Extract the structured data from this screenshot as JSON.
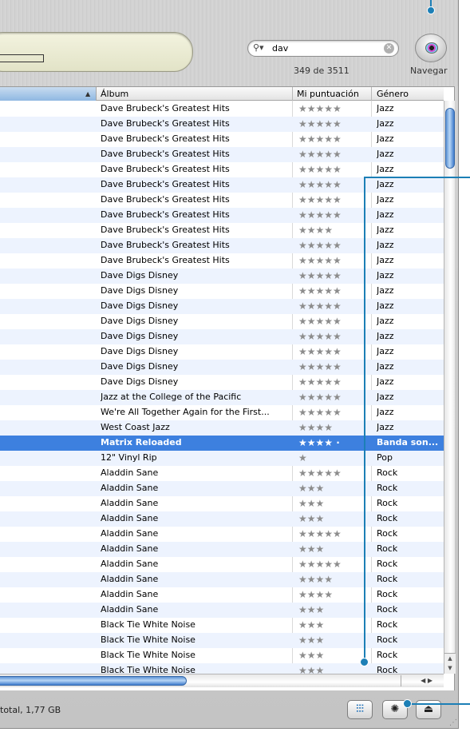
{
  "search": {
    "value": "dav",
    "placeholder": ""
  },
  "result_count": "349 de 3511",
  "browse_label": "Navegar",
  "columns": {
    "album": "Álbum",
    "rating": "Mi puntuación",
    "genre": "Género"
  },
  "rows": [
    {
      "album": "Dave Brubeck's Greatest Hits",
      "rating": "★★★★★",
      "genre": "Jazz"
    },
    {
      "album": "Dave Brubeck's Greatest Hits",
      "rating": "★★★★★",
      "genre": "Jazz"
    },
    {
      "album": "Dave Brubeck's Greatest Hits",
      "rating": "★★★★★",
      "genre": "Jazz"
    },
    {
      "album": "Dave Brubeck's Greatest Hits",
      "rating": "★★★★★",
      "genre": "Jazz"
    },
    {
      "album": "Dave Brubeck's Greatest Hits",
      "rating": "★★★★★",
      "genre": "Jazz"
    },
    {
      "album": "Dave Brubeck's Greatest Hits",
      "rating": "★★★★★",
      "genre": "Jazz"
    },
    {
      "album": "Dave Brubeck's Greatest Hits",
      "rating": "★★★★★",
      "genre": "Jazz"
    },
    {
      "album": "Dave Brubeck's Greatest Hits",
      "rating": "★★★★★",
      "genre": "Jazz"
    },
    {
      "album": "Dave Brubeck's Greatest Hits",
      "rating": "★★★★",
      "genre": "Jazz"
    },
    {
      "album": "Dave Brubeck's Greatest Hits",
      "rating": "★★★★★",
      "genre": "Jazz"
    },
    {
      "album": "Dave Brubeck's Greatest Hits",
      "rating": "★★★★★",
      "genre": "Jazz"
    },
    {
      "album": "Dave Digs Disney",
      "rating": "★★★★★",
      "genre": "Jazz"
    },
    {
      "album": "Dave Digs Disney",
      "rating": "★★★★★",
      "genre": "Jazz"
    },
    {
      "album": "Dave Digs Disney",
      "rating": "★★★★★",
      "genre": "Jazz"
    },
    {
      "album": "Dave Digs Disney",
      "rating": "★★★★★",
      "genre": "Jazz"
    },
    {
      "album": "Dave Digs Disney",
      "rating": "★★★★★",
      "genre": "Jazz"
    },
    {
      "album": "Dave Digs Disney",
      "rating": "★★★★★",
      "genre": "Jazz"
    },
    {
      "album": "Dave Digs Disney",
      "rating": "★★★★★",
      "genre": "Jazz"
    },
    {
      "album": "Dave Digs Disney",
      "rating": "★★★★★",
      "genre": "Jazz"
    },
    {
      "album": "Jazz at the College of the Pacific",
      "rating": "★★★★★",
      "genre": "Jazz"
    },
    {
      "album": "We're All Together Again for the First...",
      "rating": "★★★★★",
      "genre": "Jazz"
    },
    {
      "album": "West Coast Jazz",
      "rating": "★★★★",
      "genre": "Jazz"
    },
    {
      "album": "Matrix Reloaded",
      "rating": "★★★★ ·",
      "genre": "Banda son...",
      "selected": true
    },
    {
      "album": "12\" Vinyl Rip",
      "rating": "★",
      "genre": "Pop"
    },
    {
      "album": "Aladdin Sane",
      "rating": "★★★★★",
      "genre": "Rock"
    },
    {
      "album": "Aladdin Sane",
      "rating": "★★★",
      "genre": "Rock"
    },
    {
      "album": "Aladdin Sane",
      "rating": "★★★",
      "genre": "Rock"
    },
    {
      "album": "Aladdin Sane",
      "rating": "★★★",
      "genre": "Rock"
    },
    {
      "album": "Aladdin Sane",
      "rating": "★★★★★",
      "genre": "Rock"
    },
    {
      "album": "Aladdin Sane",
      "rating": "★★★",
      "genre": "Rock"
    },
    {
      "album": "Aladdin Sane",
      "rating": "★★★★★",
      "genre": "Rock"
    },
    {
      "album": "Aladdin Sane",
      "rating": "★★★★",
      "genre": "Rock"
    },
    {
      "album": "Aladdin Sane",
      "rating": "★★★★",
      "genre": "Rock"
    },
    {
      "album": "Aladdin Sane",
      "rating": "★★★",
      "genre": "Rock"
    },
    {
      "album": "Black Tie White Noise",
      "rating": "★★★",
      "genre": "Rock"
    },
    {
      "album": "Black Tie White Noise",
      "rating": "★★★",
      "genre": "Rock"
    },
    {
      "album": "Black Tie White Noise",
      "rating": "★★★",
      "genre": "Rock"
    },
    {
      "album": "Black Tie White Noise",
      "rating": "★★★",
      "genre": "Rock"
    }
  ],
  "status_text": "total, 1,77 GB",
  "icons": {
    "search": "search-icon",
    "clear": "clear-icon",
    "browse": "eye-icon",
    "equalizer": "equalizer-icon",
    "visualizer": "visualizer-icon",
    "eject": "eject-icon"
  },
  "colors": {
    "selection": "#3d80df",
    "callout": "#1c7fb6",
    "lcd": "#e9eacf"
  }
}
